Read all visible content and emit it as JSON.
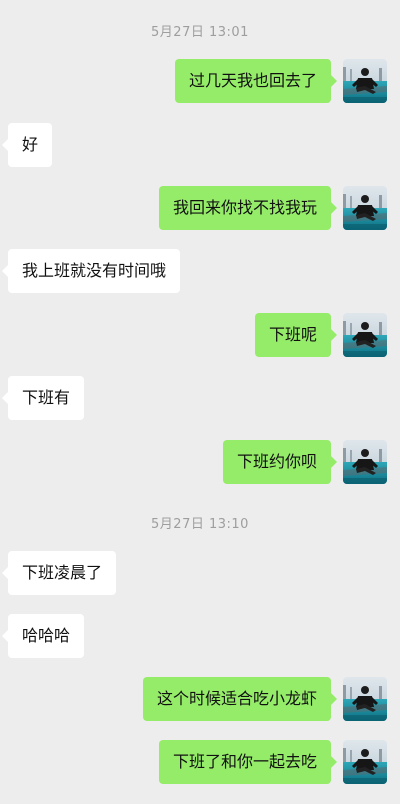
{
  "messages": [
    {
      "type": "timestamp",
      "text": "5月27日 13:01"
    },
    {
      "type": "out",
      "text": "过几天我也回去了"
    },
    {
      "type": "in",
      "text": "好"
    },
    {
      "type": "out",
      "text": "我回来你找不找我玩"
    },
    {
      "type": "in",
      "text": "我上班就没有时间哦"
    },
    {
      "type": "out",
      "text": "下班呢"
    },
    {
      "type": "in",
      "text": "下班有"
    },
    {
      "type": "out",
      "text": "下班约你呗"
    },
    {
      "type": "timestamp",
      "text": "5月27日 13:10"
    },
    {
      "type": "in",
      "text": "下班凌晨了"
    },
    {
      "type": "in",
      "text": "哈哈哈"
    },
    {
      "type": "out",
      "text": "这个时候适合吃小龙虾"
    },
    {
      "type": "out",
      "text": "下班了和你一起去吃"
    }
  ],
  "colors": {
    "background": "#ededed",
    "outgoing_bubble": "#95ec69",
    "incoming_bubble": "#ffffff",
    "timestamp_text": "#9e9e9e"
  },
  "icons": {
    "sender_avatar": "avatar-photo-icon"
  }
}
